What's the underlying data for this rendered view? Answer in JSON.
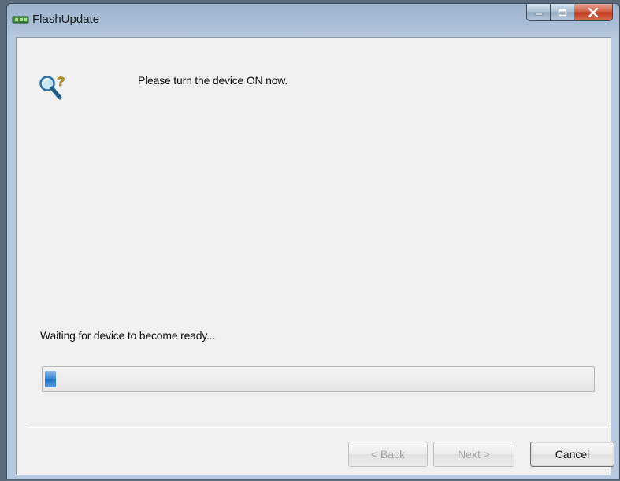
{
  "window": {
    "title": "FlashUpdate",
    "app_icon": "flash-chip-icon"
  },
  "caption": {
    "minimize_icon": "minimize-icon",
    "maximize_icon": "maximize-icon",
    "close_icon": "close-icon"
  },
  "content": {
    "status_icon": "magnifier-question-icon",
    "instruction": "Please turn the device ON now.",
    "status_text": "Waiting for device to become ready...",
    "progress_fraction": 0.02
  },
  "buttons": {
    "back_label": "< Back",
    "next_label": "Next >",
    "cancel_label": "Cancel",
    "back_enabled": false,
    "next_enabled": false,
    "cancel_enabled": true
  },
  "colors": {
    "progress_fill": "#2f80d2",
    "close_button": "#c8462b"
  }
}
